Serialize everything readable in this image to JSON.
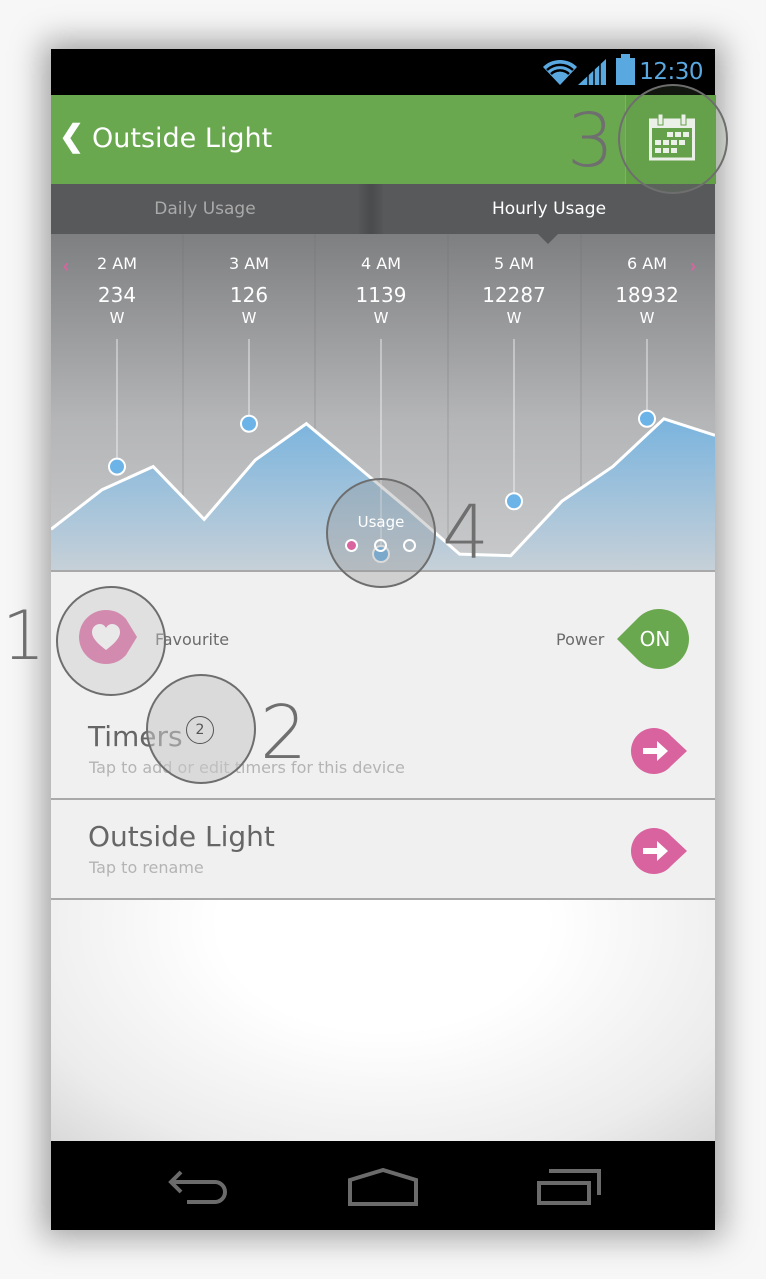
{
  "status_bar": {
    "time": "12:30",
    "icons": [
      "wifi-icon",
      "signal-icon",
      "battery-icon"
    ],
    "accent_color": "#5aa8e0"
  },
  "app_bar": {
    "back_label": "❮",
    "title": "Outside Light",
    "calendar_icon": "calendar-icon",
    "background_color": "#6aa84f"
  },
  "tabs": [
    {
      "label": "Daily Usage",
      "active": false
    },
    {
      "label": "Hourly Usage",
      "active": true
    }
  ],
  "usage": {
    "prev_label": "‹",
    "next_label": "›",
    "columns": [
      {
        "time": "2 AM",
        "value": "234",
        "unit": "W"
      },
      {
        "time": "3 AM",
        "value": "126",
        "unit": "W"
      },
      {
        "time": "4 AM",
        "value": "1139",
        "unit": "W"
      },
      {
        "time": "5 AM",
        "value": "12287",
        "unit": "W"
      },
      {
        "time": "6 AM",
        "value": "18932",
        "unit": "W"
      }
    ],
    "pager_label": "Usage",
    "pager_pages": 3,
    "pager_active": 0,
    "accent_color": "#d9639f"
  },
  "chart_data": {
    "type": "area",
    "title": "Hourly Usage",
    "categories": [
      "2 AM",
      "3 AM",
      "4 AM",
      "5 AM",
      "6 AM"
    ],
    "series": [
      {
        "name": "Usage (W)",
        "values": [
          234,
          126,
          1139,
          12287,
          18932
        ]
      }
    ],
    "visual_profile": [
      0.18,
      0.42,
      0.56,
      0.24,
      0.6,
      0.82,
      0.56,
      0.3,
      0.03,
      0.02,
      0.35,
      0.56,
      0.85,
      0.75
    ],
    "marker_levels": [
      0.56,
      0.82,
      0.03,
      0.35,
      0.85
    ],
    "xlabel": "",
    "ylabel": "",
    "grid": true,
    "fill_color": "#7ab4de",
    "point_color": "#6cb4e8"
  },
  "favourite": {
    "label": "Favourite",
    "icon": "heart-icon",
    "color": "#d9639f"
  },
  "power": {
    "label": "Power",
    "state": "ON",
    "color": "#6aa84f"
  },
  "list_items": [
    {
      "title": "Timers",
      "subtitle": "Tap to add or edit timers for this device",
      "icon": "arrow-right-icon"
    },
    {
      "title": "Outside Light",
      "subtitle": "Tap to rename",
      "icon": "arrow-right-icon"
    }
  ],
  "annotations": [
    "1",
    "2",
    "3",
    "4"
  ],
  "annotation_badge": "2",
  "nav_bar": {
    "buttons": [
      "back-icon",
      "home-icon",
      "recent-apps-icon"
    ]
  }
}
